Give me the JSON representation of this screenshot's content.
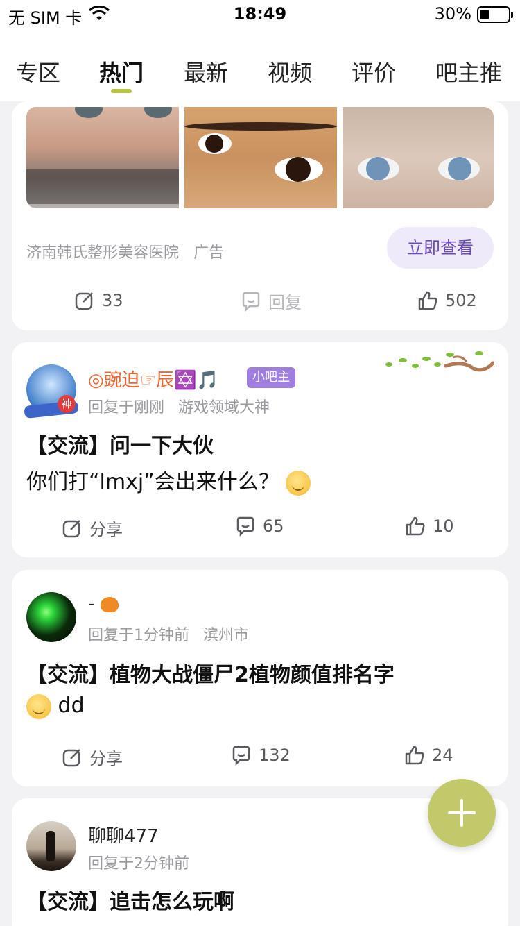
{
  "status_bar": {
    "carrier": "无 SIM 卡",
    "time": "18:49",
    "battery": "30%"
  },
  "tabs": [
    {
      "label": "专区"
    },
    {
      "label": "热门"
    },
    {
      "label": "最新"
    },
    {
      "label": "视频"
    },
    {
      "label": "评价"
    },
    {
      "label": "吧主推"
    }
  ],
  "ad": {
    "source": "济南韩氏整形美容医院",
    "tag": "广告",
    "cta": "立即查看",
    "share_count": "33",
    "reply_label": "回复",
    "likes": "502"
  },
  "posts": [
    {
      "user": "◎豌迫☞辰✡️🎵",
      "badge": "小吧主",
      "avatar_tag": "神",
      "time": "回复于刚刚",
      "meta": "游戏领域大神",
      "title": "【交流】问一下大伙",
      "body": "你们打“lmxj”会出来什么？",
      "share_label": "分享",
      "comments": "65",
      "likes": "10"
    },
    {
      "user": "- ",
      "time": "回复于1分钟前",
      "meta": "滨州市",
      "title": "【交流】植物大战僵尸2植物颜值排名字",
      "body": "dd",
      "share_label": "分享",
      "comments": "132",
      "likes": "24"
    },
    {
      "user": "聊聊477",
      "time": "回复于2分钟前",
      "title": "【交流】追击怎么玩啊"
    }
  ],
  "colors": {
    "accent": "#b8c440",
    "fab": "#c2c96a",
    "badge": "#9f7ee0",
    "cta_text": "#6b49c0"
  }
}
